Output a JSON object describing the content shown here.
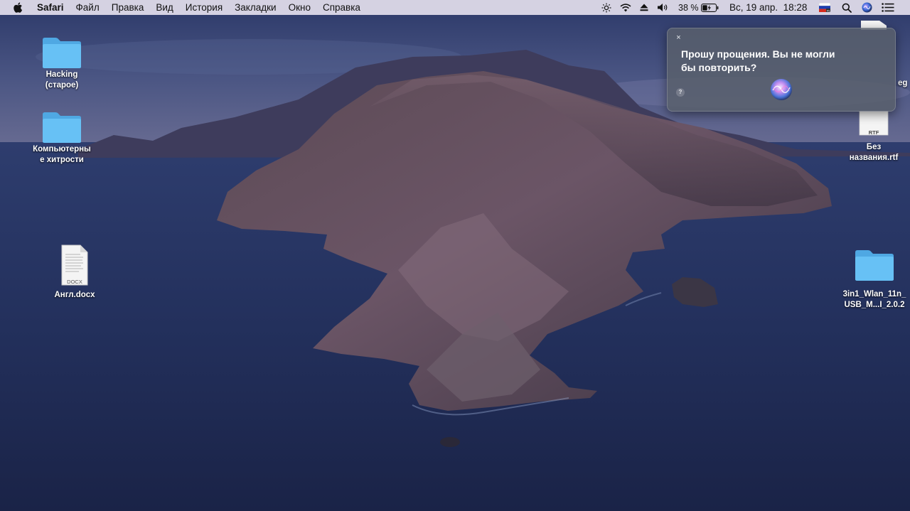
{
  "menubar": {
    "app_name": "Safari",
    "menus": [
      "Файл",
      "Правка",
      "Вид",
      "История",
      "Закладки",
      "Окно",
      "Справка"
    ],
    "battery_percent": "38 %",
    "datetime": "Вс, 19 апр.  18:28"
  },
  "desktop": {
    "left_icons": [
      {
        "label": "Hacking\n(старое)",
        "type": "folder"
      },
      {
        "label": "Компьютерны\nе хитрости",
        "type": "folder"
      },
      {
        "label": "Англ.docx",
        "type": "docx",
        "badge": "DOCX"
      }
    ],
    "right_icons": [
      {
        "label": "eg",
        "type": "file"
      },
      {
        "label": "Без\nназвания.rtf",
        "type": "rtf",
        "badge": "RTF"
      },
      {
        "label": "3in1_Wlan_11n_\nUSB_M...I_2.0.2",
        "type": "folder"
      }
    ]
  },
  "siri": {
    "message": "Прошу прощения. Вы не могли бы повторить?",
    "close_glyph": "×",
    "help_glyph": "?"
  },
  "colors": {
    "folder_front": "#67c1f5",
    "folder_back": "#4fa8e3",
    "menubar_bg": "#e2deec",
    "siri_bg": "#58606c"
  },
  "icons": [
    "apple-icon",
    "brightness-icon",
    "wifi-icon",
    "eject-icon",
    "volume-icon",
    "battery-icon",
    "flag-icon",
    "search-icon",
    "siri-icon",
    "menu-icon",
    "folder-icon",
    "document-icon"
  ]
}
